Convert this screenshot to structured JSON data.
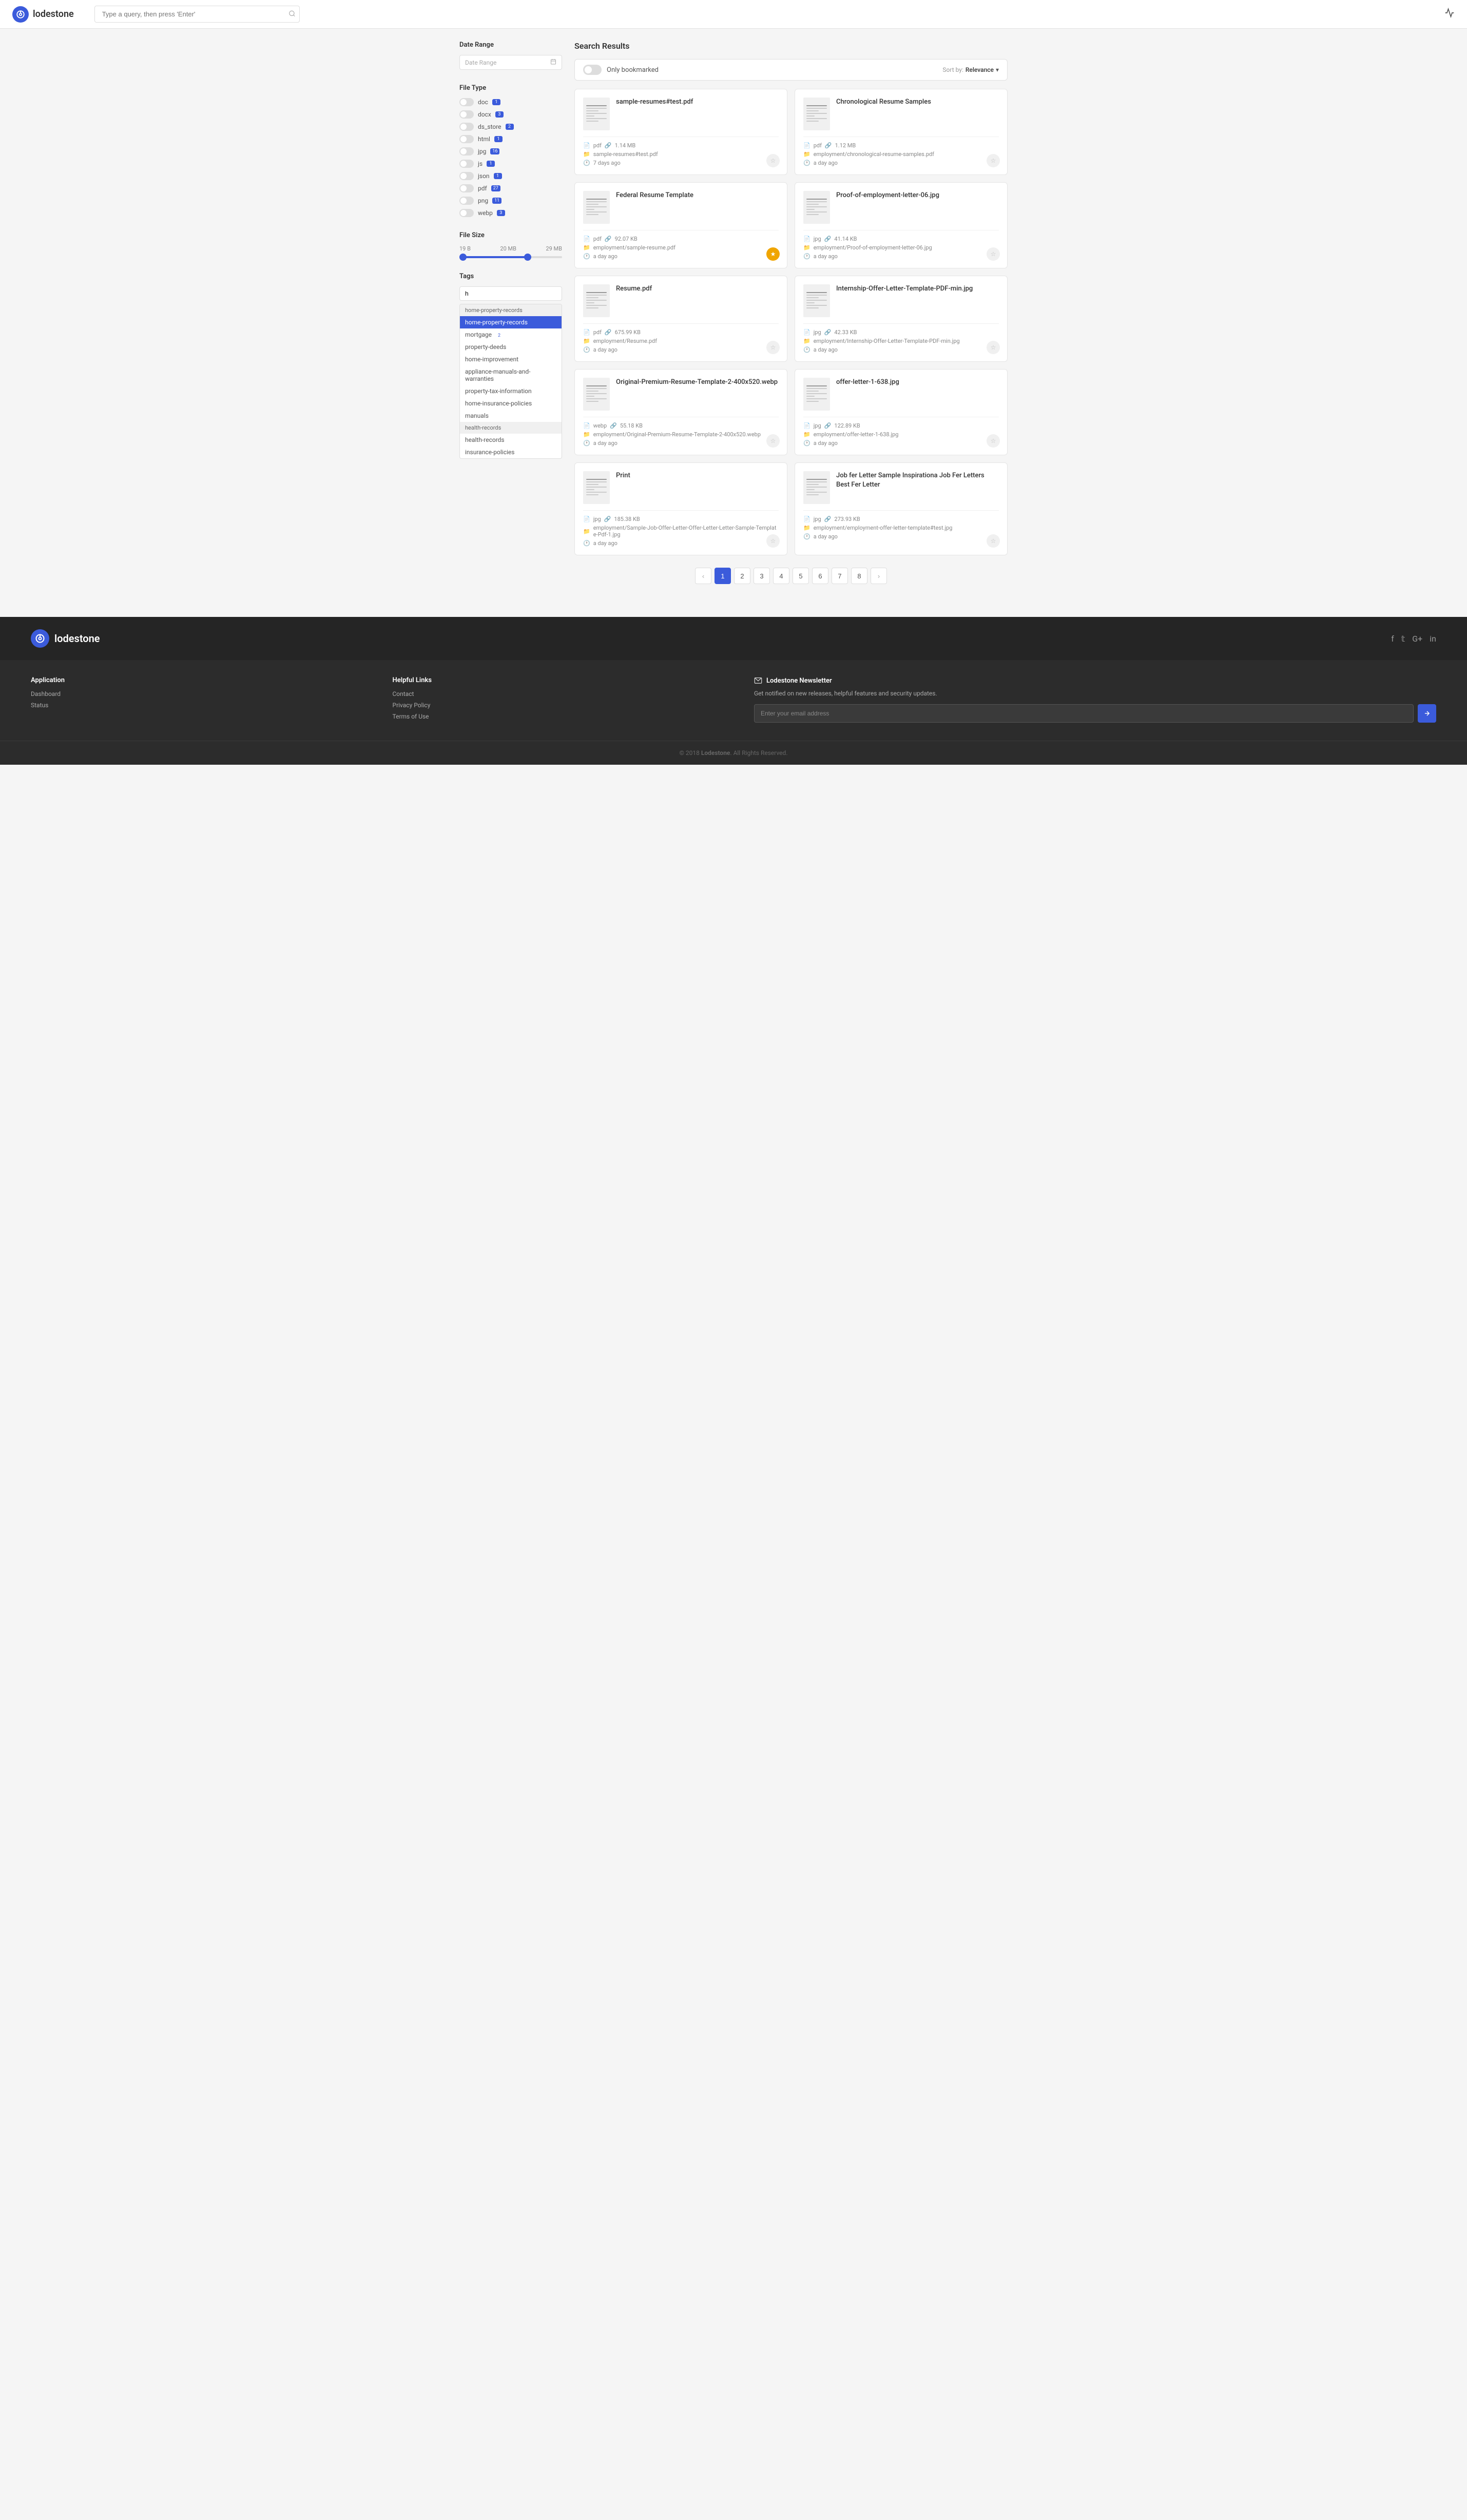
{
  "header": {
    "logo_text": "lodestone",
    "search_placeholder": "Type a query, then press 'Enter'",
    "activity_icon": "⚡"
  },
  "sidebar": {
    "date_range": {
      "label": "Date Range",
      "placeholder": "Date Range"
    },
    "file_type": {
      "label": "File Type",
      "items": [
        {
          "name": "doc",
          "count": "1",
          "enabled": false
        },
        {
          "name": "docx",
          "count": "3",
          "enabled": false
        },
        {
          "name": "ds_store",
          "count": "2",
          "enabled": false
        },
        {
          "name": "html",
          "count": "1",
          "enabled": false
        },
        {
          "name": "jpg",
          "count": "16",
          "enabled": false
        },
        {
          "name": "js",
          "count": "1",
          "enabled": false
        },
        {
          "name": "json",
          "count": "1",
          "enabled": false
        },
        {
          "name": "pdf",
          "count": "27",
          "enabled": false
        },
        {
          "name": "png",
          "count": "11",
          "enabled": false
        },
        {
          "name": "webp",
          "count": "3",
          "enabled": false
        }
      ]
    },
    "file_size": {
      "label": "File Size",
      "min": "19 B",
      "mid": "20 MB",
      "max": "29 MB"
    },
    "tags": {
      "label": "Tags",
      "search_value": "h",
      "groups": [
        {
          "name": "home-property-records",
          "items": [
            {
              "label": "home-property-records",
              "selected": true,
              "count": null
            },
            {
              "label": "mortgage",
              "selected": false,
              "count": "2"
            },
            {
              "label": "property-deeds",
              "selected": false,
              "count": null
            },
            {
              "label": "home-improvement",
              "selected": false,
              "count": null
            },
            {
              "label": "appliance-manuals-and-warranties",
              "selected": false,
              "count": null
            },
            {
              "label": "property-tax-information",
              "selected": false,
              "count": null
            },
            {
              "label": "home-insurance-policies",
              "selected": false,
              "count": null
            },
            {
              "label": "manuals",
              "selected": false,
              "count": null
            }
          ]
        },
        {
          "name": "health-records",
          "items": [
            {
              "label": "health-records",
              "selected": false,
              "count": null
            },
            {
              "label": "insurance-policies",
              "selected": false,
              "count": null
            }
          ]
        }
      ]
    }
  },
  "results": {
    "title": "Search Results",
    "filter_bar": {
      "bookmarked_label": "Only bookmarked",
      "sort_label": "Sort by:",
      "sort_value": "Relevance"
    },
    "cards": [
      {
        "id": 1,
        "title": "sample-resumes#test.pdf",
        "type": "pdf",
        "size": "1.14 MB",
        "path": "sample-resumes#test.pdf",
        "date": "7 days ago",
        "bookmarked": false
      },
      {
        "id": 2,
        "title": "Chronological Resume Samples",
        "type": "pdf",
        "size": "1.12 MB",
        "path": "employment/chronological-resume-samples.pdf",
        "date": "a day ago",
        "bookmarked": false
      },
      {
        "id": 3,
        "title": "Federal Resume Template",
        "type": "pdf",
        "size": "92.07 KB",
        "path": "employment/sample-resume.pdf",
        "date": "a day ago",
        "bookmarked": true
      },
      {
        "id": 4,
        "title": "Proof-of-employment-letter-06.jpg",
        "type": "jpg",
        "size": "41.14 KB",
        "path": "employment/Proof-of-employment-letter-06.jpg",
        "date": "a day ago",
        "bookmarked": false
      },
      {
        "id": 5,
        "title": "Resume.pdf",
        "type": "pdf",
        "size": "675.99 KB",
        "path": "employment/Resume.pdf",
        "date": "a day ago",
        "bookmarked": false
      },
      {
        "id": 6,
        "title": "Internship-Offer-Letter-Template-PDF-min.jpg",
        "type": "jpg",
        "size": "42.33 KB",
        "path": "employment/Internship-Offer-Letter-Template-PDF-min.jpg",
        "date": "a day ago",
        "bookmarked": false
      },
      {
        "id": 7,
        "title": "Original-Premium-Resume-Template-2-400x520.webp",
        "type": "webp",
        "size": "55.18 KB",
        "path": "employment/Original-Premium-Resume-Template-2-400x520.webp",
        "date": "a day ago",
        "bookmarked": false
      },
      {
        "id": 8,
        "title": "offer-letter-1-638.jpg",
        "type": "jpg",
        "size": "122.89 KB",
        "path": "employment/offer-letter-1-638.jpg",
        "date": "a day ago",
        "bookmarked": false
      },
      {
        "id": 9,
        "title": "Print",
        "type": "jpg",
        "size": "185.38 KB",
        "path": "employment/Sample-Job-Offer-Letter-Offer-Letter-Letter-Sample-Template-Pdf-1.jpg",
        "date": "a day ago",
        "bookmarked": false
      },
      {
        "id": 10,
        "title": "Job fer Letter Sample Inspirationa Job Fer Letters Best Fer Letter",
        "type": "jpg",
        "size": "273.93 KB",
        "path": "employment/employment-offer-letter-template#test.jpg",
        "date": "a day ago",
        "bookmarked": false
      }
    ],
    "pagination": {
      "pages": [
        "1",
        "2",
        "3",
        "4",
        "5",
        "6",
        "7",
        "8"
      ],
      "current": "1"
    }
  },
  "footer": {
    "logo": "lodestone",
    "social": [
      "f",
      "t",
      "G+",
      "in"
    ],
    "columns": [
      {
        "title": "Application",
        "links": [
          "Dashboard",
          "Status"
        ]
      },
      {
        "title": "Helpful Links",
        "links": [
          "Contact",
          "Privacy Policy",
          "Terms of Use"
        ]
      }
    ],
    "newsletter": {
      "title": "Lodestone Newsletter",
      "description": "Get notified on new releases, helpful features and security updates.",
      "input_placeholder": "Enter your email address"
    },
    "copyright": "© 2018 Lodestone. All Rights Reserved."
  }
}
